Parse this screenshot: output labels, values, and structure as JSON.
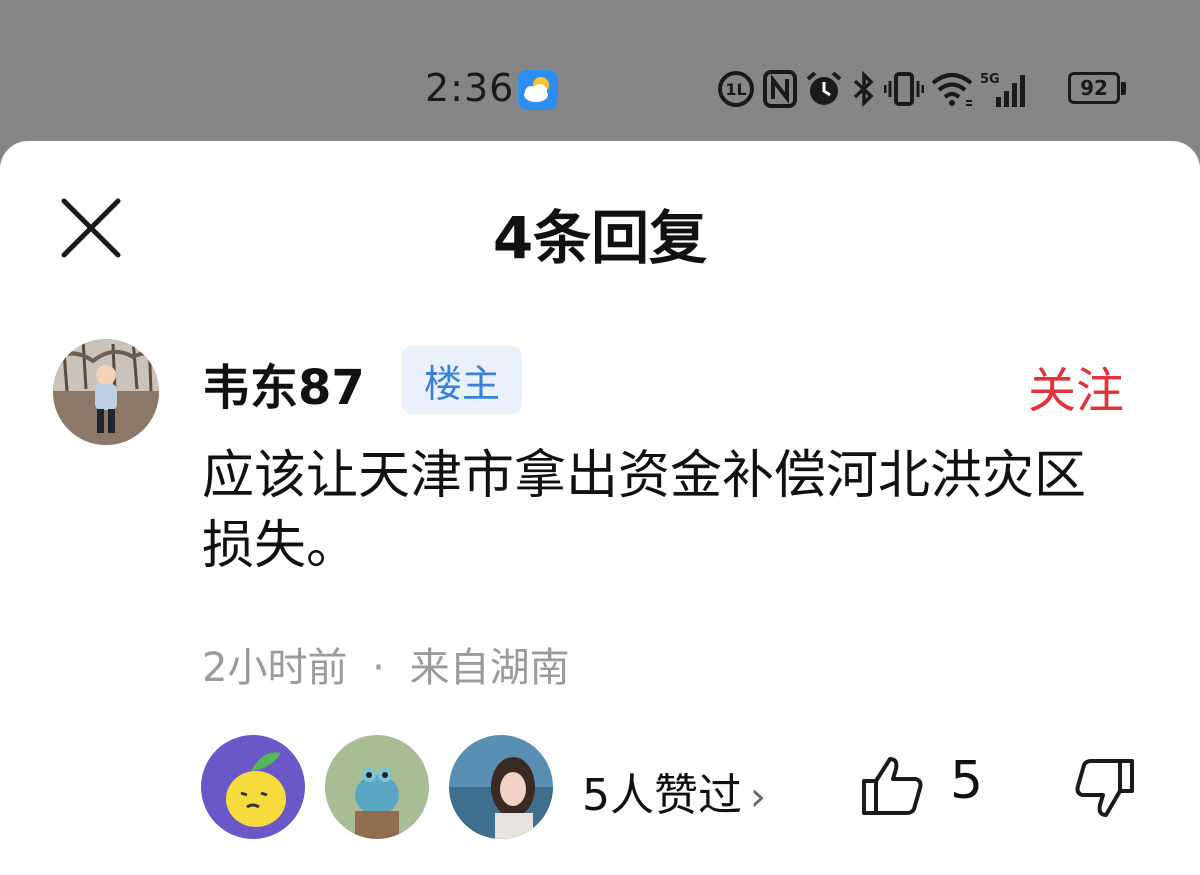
{
  "status_bar": {
    "time": "2:36",
    "network": "5G",
    "battery": "92",
    "icons": [
      "weather-partly-cloudy-icon",
      "data-saver-icon",
      "nfc-icon",
      "alarm-icon",
      "bluetooth-icon",
      "vibrate-icon",
      "wifi-icon",
      "signal-icon",
      "battery-icon"
    ]
  },
  "sheet": {
    "title": "4条回复",
    "close_icon": "close-icon"
  },
  "comment": {
    "username": "韦东87",
    "badge": "楼主",
    "follow": "关注",
    "text": "应该让天津市拿出资金补偿河北洪灾区损失。",
    "time": "2小时前",
    "separator": "·",
    "location": "来自湖南"
  },
  "likes": {
    "likers_text": "5人赞过",
    "chevron": "›",
    "count": "5"
  },
  "colors": {
    "accent_red": "#e0343c",
    "badge_bg": "#e8f1fc",
    "badge_text": "#3b7fd9",
    "meta_gray": "#9b9b9b",
    "overlay": "#868686"
  }
}
